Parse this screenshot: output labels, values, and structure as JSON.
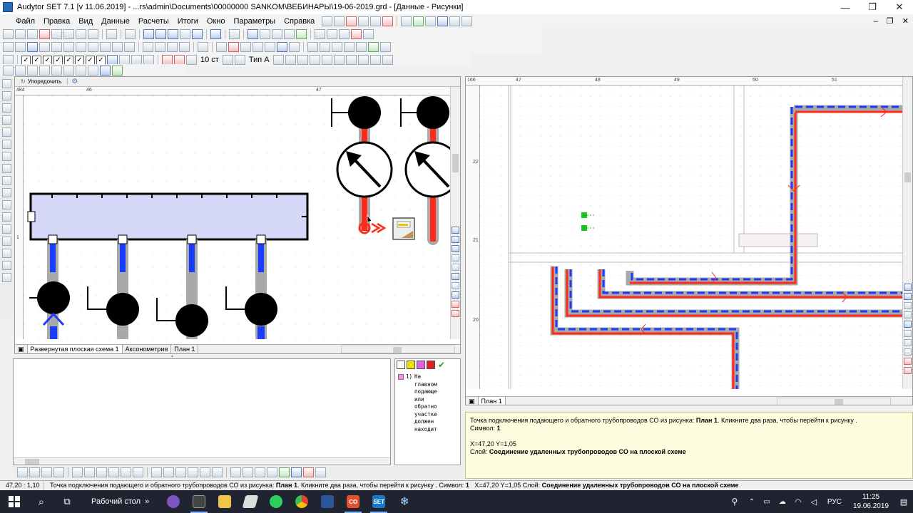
{
  "window": {
    "title": "Audytor SET 7.1   [v 11.06.2019]  - ...rs\\admin\\Documents\\00000000 SANKOM\\ВЕБИНАРЫ\\19-06-2019.grd - [Данные - Рисунки]",
    "minimize": "—",
    "restore": "❐",
    "close": "✕",
    "inner_minimize": "–",
    "inner_restore": "❐",
    "inner_close": "✕"
  },
  "menu": {
    "items": [
      "Файл",
      "Правка",
      "Вид",
      "Данные",
      "Расчеты",
      "Итоги",
      "Окно",
      "Параметры",
      "Справка"
    ]
  },
  "toolbar3": {
    "font_size_value": "10 ст",
    "line_type_label": "Тип А"
  },
  "left_panel": {
    "arrange_button": "Упорядочить",
    "ruler_corner": "484",
    "ruler_h_ticks": [
      "46",
      "47"
    ],
    "ruler_v_tick": "1",
    "tabs": [
      "Развернутая плоская схема 1",
      "Аксонометрия",
      "План 1"
    ]
  },
  "message_list": {
    "item_number": "1)",
    "item_text_lines": [
      "На",
      "главном",
      "подающе",
      "или",
      "обратно",
      "участке",
      "должен",
      "находит"
    ]
  },
  "right_panel": {
    "ruler_corner": "166",
    "ruler_h_ticks": [
      "47",
      "48",
      "49",
      "50",
      "51"
    ],
    "ruler_v_ticks": [
      "22",
      "21",
      "20"
    ],
    "tab": "План 1"
  },
  "info_box": {
    "line1_prefix": "Точка подключения подающего и обратного трубопроводов СО из рисунка: ",
    "line1_bold": "План 1",
    "line1_suffix": ". Кликните два раза, чтобы перейти к рисунку .",
    "symbol_label": "Символ: ",
    "symbol_value": "1",
    "coords": "X=47,20 Y=1,05",
    "layer_label": "Слой: ",
    "layer_value": "Соединение удаленных трубопроводов СО на плоской схеме"
  },
  "statusbar": {
    "position": "47,20 : 1,10",
    "message_prefix": "Точка подключения подающего и обратного трубопроводов СО из рисунка: ",
    "message_bold": "План 1",
    "message_mid": ". Кликните два раза, чтобы перейти к рисунку . Символ: ",
    "symbol_value": "1",
    "coords": "X=47,20 Y=1,05 Слой: ",
    "layer_value": "Соединение удаленных трубопроводов СО на плоской схеме"
  },
  "taskbar": {
    "desktop_label": "Рабочий стол",
    "language": "РУС",
    "time": "11:25",
    "date": "19.06.2019",
    "app_label_co": "CO",
    "app_label_set": "SET"
  },
  "colors": {
    "supply_red": "#ff2a1a",
    "return_blue": "#1a3cff",
    "pipe_gray": "#a9a9a9",
    "manifold_fill": "#d5d7f6",
    "taskbar": "#1f2430"
  },
  "icons": [
    "search-icon",
    "task-view-icon",
    "chrome-icon",
    "word-icon",
    "whatsapp-icon",
    "viber-icon",
    "calculator-icon",
    "folder-icon"
  ]
}
